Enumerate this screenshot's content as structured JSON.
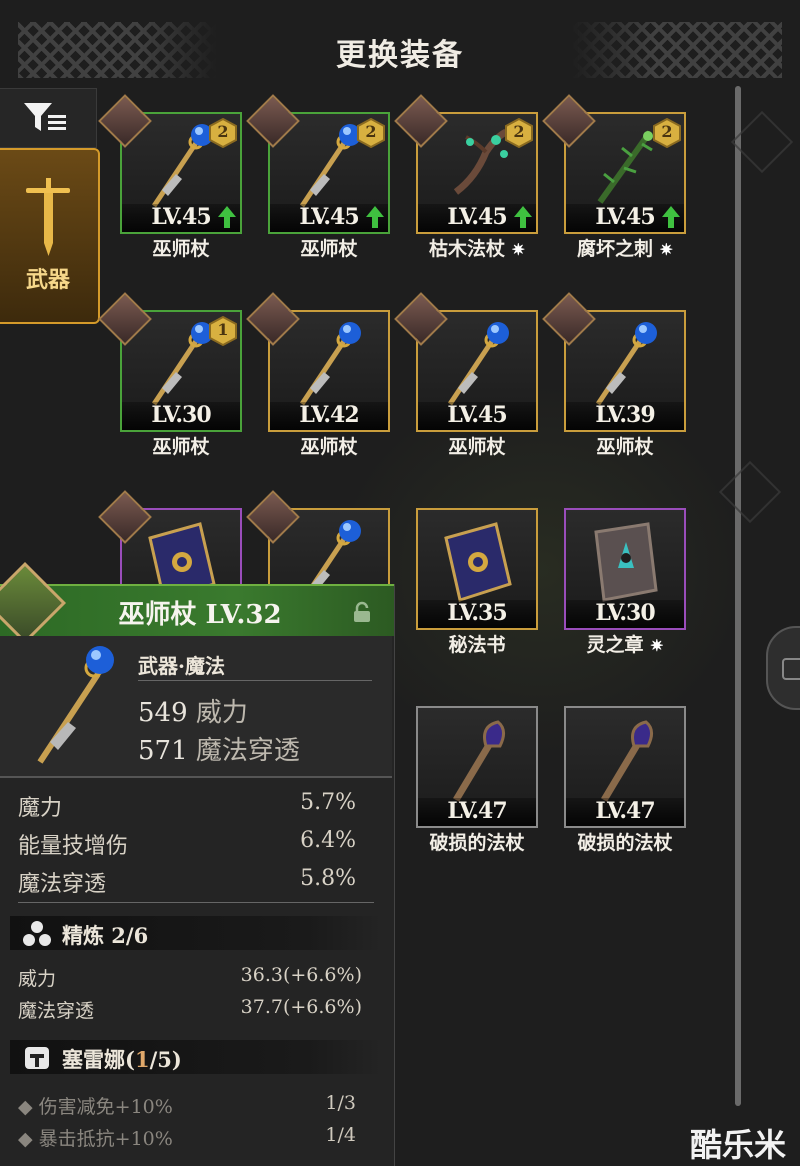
{
  "header": {
    "title": "更换装备"
  },
  "tabs": {
    "weapon_label": "武器"
  },
  "items": [
    {
      "level": "LV.45",
      "name": "巫师杖",
      "rarity": "green",
      "badge": "2",
      "upgrade": true,
      "type": "staff"
    },
    {
      "level": "LV.45",
      "name": "巫师杖",
      "rarity": "green",
      "badge": "2",
      "upgrade": true,
      "type": "staff"
    },
    {
      "level": "LV.45",
      "name": "枯木法杖",
      "star": true,
      "rarity": "gold",
      "badge": "2",
      "upgrade": true,
      "type": "branch"
    },
    {
      "level": "LV.45",
      "name": "腐坏之刺",
      "star": true,
      "rarity": "gold",
      "badge": "2",
      "upgrade": true,
      "type": "thorn"
    },
    {
      "level": "LV.30",
      "name": "巫师杖",
      "rarity": "green",
      "badge": "1",
      "upgrade": false,
      "type": "staff"
    },
    {
      "level": "LV.42",
      "name": "巫师杖",
      "rarity": "gold",
      "badge": "",
      "upgrade": false,
      "type": "staff"
    },
    {
      "level": "LV.45",
      "name": "巫师杖",
      "rarity": "gold",
      "badge": "",
      "upgrade": false,
      "type": "staff"
    },
    {
      "level": "LV.39",
      "name": "巫师杖",
      "rarity": "gold",
      "badge": "",
      "upgrade": false,
      "type": "staff"
    },
    {
      "level": "",
      "name": "",
      "rarity": "purple",
      "badge": "",
      "upgrade": false,
      "type": "book"
    },
    {
      "level": "",
      "name": "",
      "rarity": "gold",
      "badge": "",
      "upgrade": false,
      "type": "staff"
    },
    {
      "level": "LV.35",
      "name": "秘法书",
      "rarity": "gold",
      "badge": "",
      "upgrade": false,
      "type": "book"
    },
    {
      "level": "LV.30",
      "name": "灵之章",
      "star": true,
      "rarity": "purple",
      "badge": "",
      "upgrade": false,
      "type": "tome"
    },
    {
      "level": "LV.47",
      "name": "破损的法杖",
      "rarity": "gray",
      "badge": "",
      "upgrade": false,
      "type": "broken"
    },
    {
      "level": "LV.47",
      "name": "破损的法杖",
      "rarity": "gray",
      "badge": "",
      "upgrade": false,
      "type": "broken"
    }
  ],
  "detail": {
    "title": "巫师杖 LV.32",
    "weapon_type": "武器·魔法",
    "main_stats": [
      {
        "value": "549",
        "label": "威力"
      },
      {
        "value": "571",
        "label": "魔法穿透"
      }
    ],
    "sub_stats": [
      {
        "label": "魔力",
        "value": "5.7%"
      },
      {
        "label": "能量技增伤",
        "value": "6.4%"
      },
      {
        "label": "魔法穿透",
        "value": "5.8%"
      }
    ],
    "refine": {
      "title": "精炼 2/6",
      "rows": [
        {
          "label": "威力",
          "value": "36.3(+6.6%)"
        },
        {
          "label": "魔法穿透",
          "value": "37.7(+6.6%)"
        }
      ]
    },
    "set": {
      "title_prefix": "塞雷娜(",
      "title_count": "1",
      "title_suffix": "/5)",
      "rows": [
        {
          "label": "伤害减免+10%",
          "value": "1/3"
        },
        {
          "label": "暴击抵抗+10%",
          "value": "1/4"
        }
      ]
    }
  },
  "watermark": "酷乐米"
}
